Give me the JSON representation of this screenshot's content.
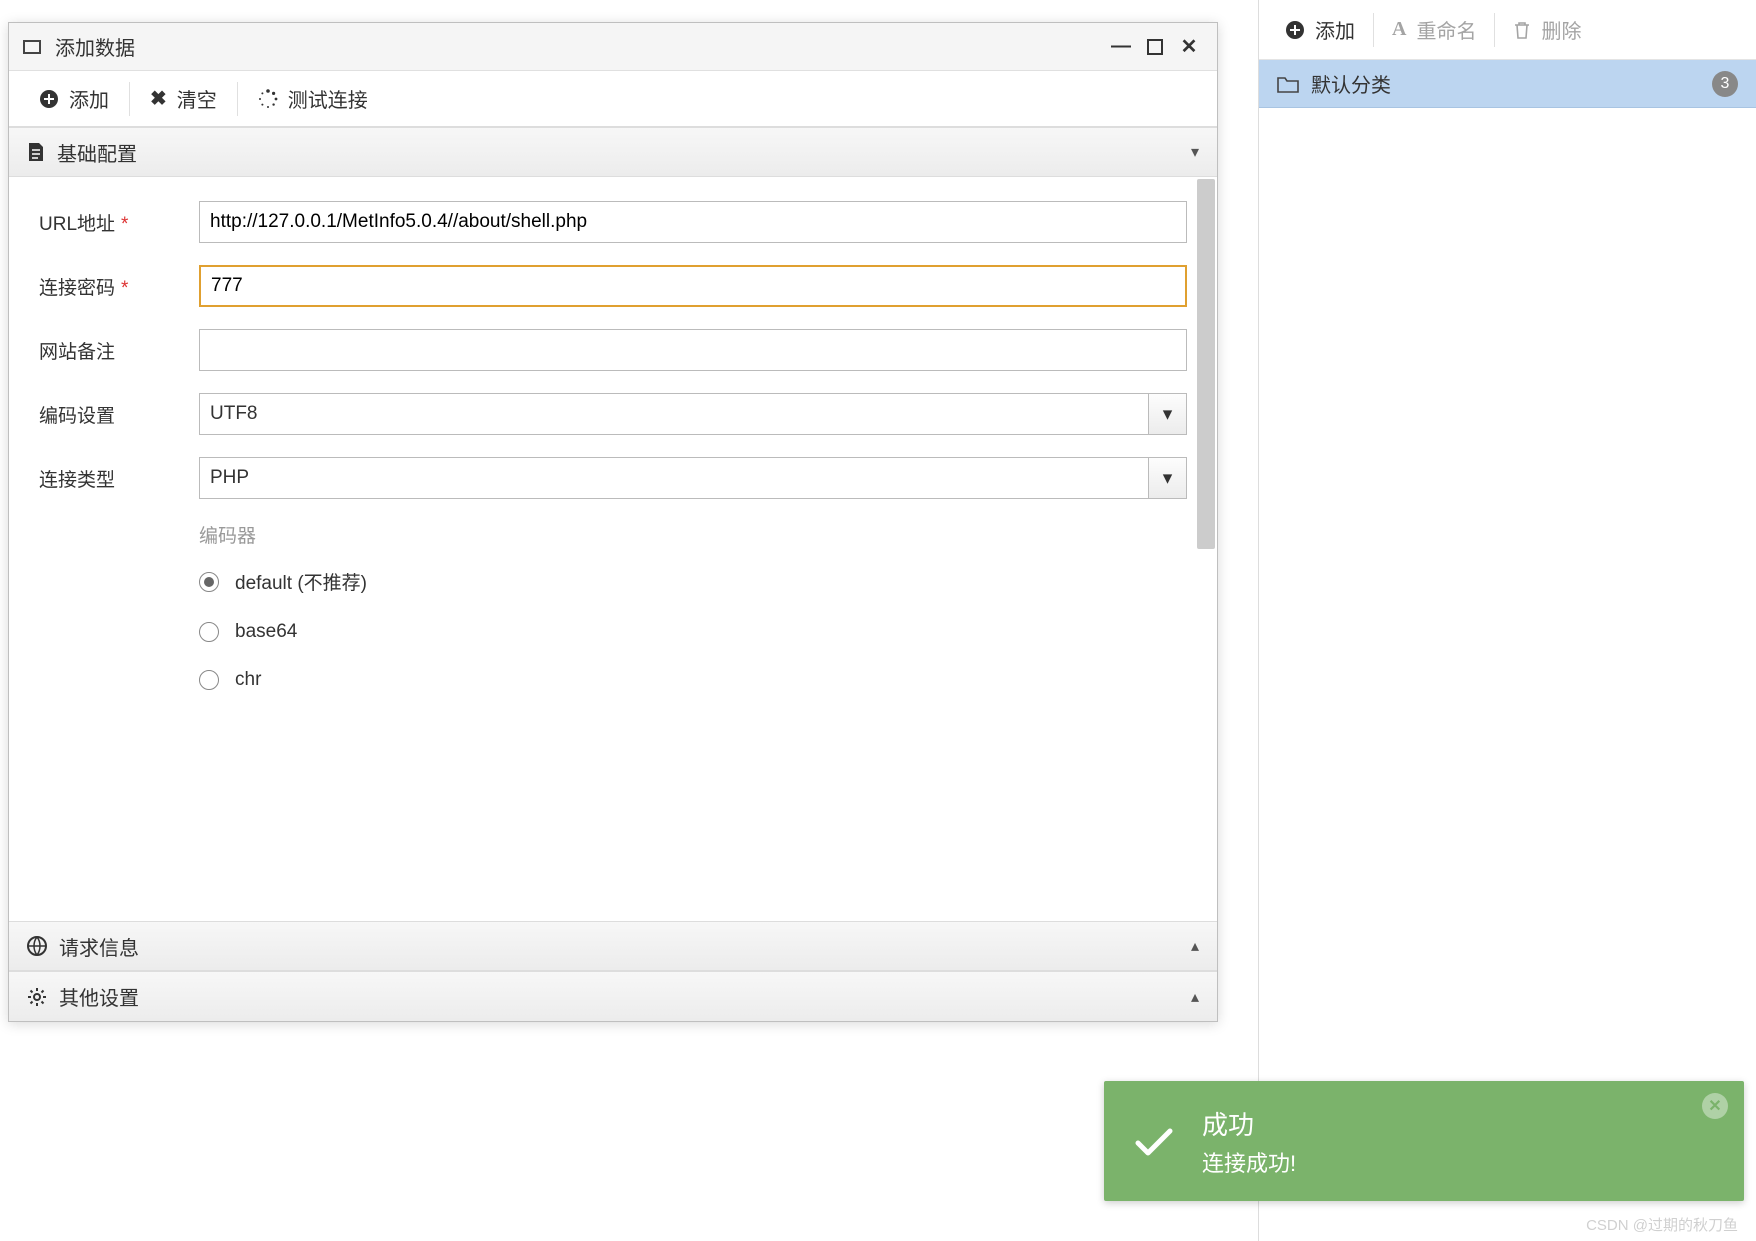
{
  "dialog": {
    "title": "添加数据",
    "toolbar": {
      "add": "添加",
      "clear": "清空",
      "test": "测试连接"
    },
    "sections": {
      "basic": "基础配置",
      "request": "请求信息",
      "other": "其他设置"
    },
    "form": {
      "url_label": "URL地址",
      "url_value": "http://127.0.0.1/MetInfo5.0.4//about/shell.php",
      "password_label": "连接密码",
      "password_value": "777",
      "note_label": "网站备注",
      "note_value": "",
      "encoding_label": "编码设置",
      "encoding_value": "UTF8",
      "type_label": "连接类型",
      "type_value": "PHP",
      "encoder_title": "编码器",
      "encoders": {
        "default": "default (不推荐)",
        "base64": "base64",
        "chr": "chr"
      }
    }
  },
  "right": {
    "toolbar": {
      "add": "添加",
      "rename": "重命名",
      "delete": "删除"
    },
    "category": {
      "name": "默认分类",
      "count": "3"
    }
  },
  "toast": {
    "title": "成功",
    "body": "连接成功!"
  },
  "watermark": "CSDN @过期的秋刀鱼"
}
